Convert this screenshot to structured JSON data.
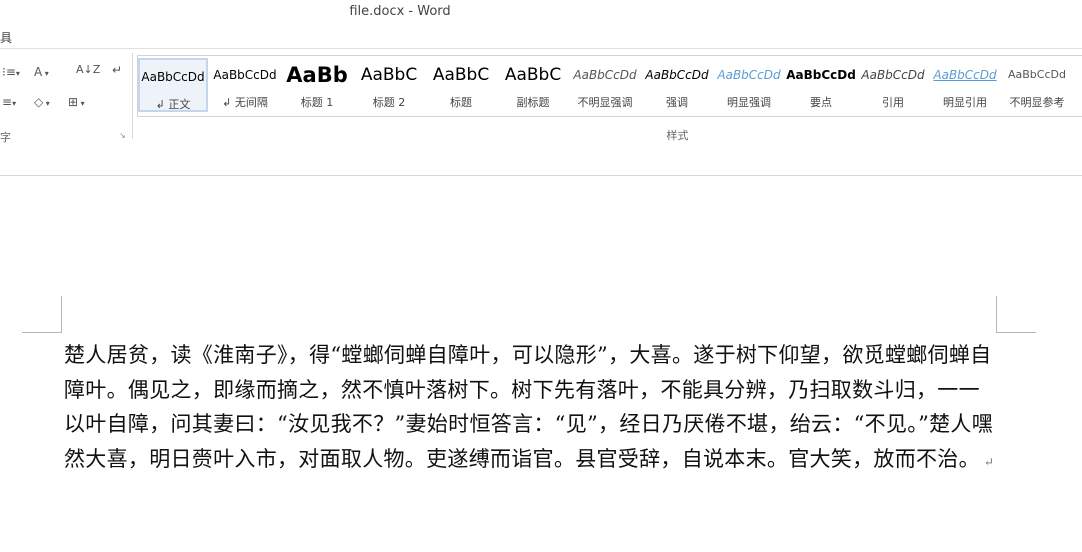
{
  "window": {
    "title": "file.docx - Word"
  },
  "tabs": {
    "visible_fragment": "具"
  },
  "ribbon": {
    "group_label": "样式",
    "para_group_label_fragment": "字",
    "controls": {
      "bullets_glyph": "⁝≡",
      "sort_glyph": "A↓Z",
      "shading_glyph": "◇",
      "borders_glyph": "⊞",
      "asian_layout_glyph": "A",
      "show_marks_glyph": "↵",
      "launcher_glyph": "↘"
    },
    "styles": [
      {
        "preview": "AaBbCcDd",
        "name": "↲ 正文",
        "selected": true
      },
      {
        "preview": "AaBbCcDd",
        "name": "↲ 无间隔"
      },
      {
        "preview": "AaBb",
        "name": "标题 1"
      },
      {
        "preview": "AaBbC",
        "name": "标题 2"
      },
      {
        "preview": "AaBbC",
        "name": "标题"
      },
      {
        "preview": "AaBbC",
        "name": "副标题"
      },
      {
        "preview": "AaBbCcDd",
        "name": "不明显强调"
      },
      {
        "preview": "AaBbCcDd",
        "name": "强调"
      },
      {
        "preview": "AaBbCcDd",
        "name": "明显强调"
      },
      {
        "preview": "AaBbCcDd",
        "name": "要点"
      },
      {
        "preview": "AaBbCcDd",
        "name": "引用"
      },
      {
        "preview": "AaBbCcDd",
        "name": "明显引用"
      },
      {
        "preview": "AaBbCcDd",
        "name": "不明显参考"
      }
    ]
  },
  "document": {
    "paragraph": "楚人居贫，读《淮南子》，得“螳螂伺蝉自障叶，可以隐形”，大喜。遂于树下仰望，欲觅螳螂伺蝉自障叶。偶见之，即缘而摘之，然不慎叶落树下。树下先有落叶，不能具分辨，乃扫取数斗归，一一以叶自障，问其妻曰：“汝见我不？”妻始时恒答言：“见”，经日乃厌倦不堪，绐云：“不见。”楚人嘿然大喜，明日赍叶入市，对面取人物。吏遂缚而诣官。县官受辞，自说本末。官大笑，放而不治。",
    "paragraph_mark": "↵"
  },
  "colors": {
    "accent_blue": "#2b579a",
    "selected_style_border": "#c5d6ec",
    "emphasis_blue": "#5b9bd5"
  }
}
